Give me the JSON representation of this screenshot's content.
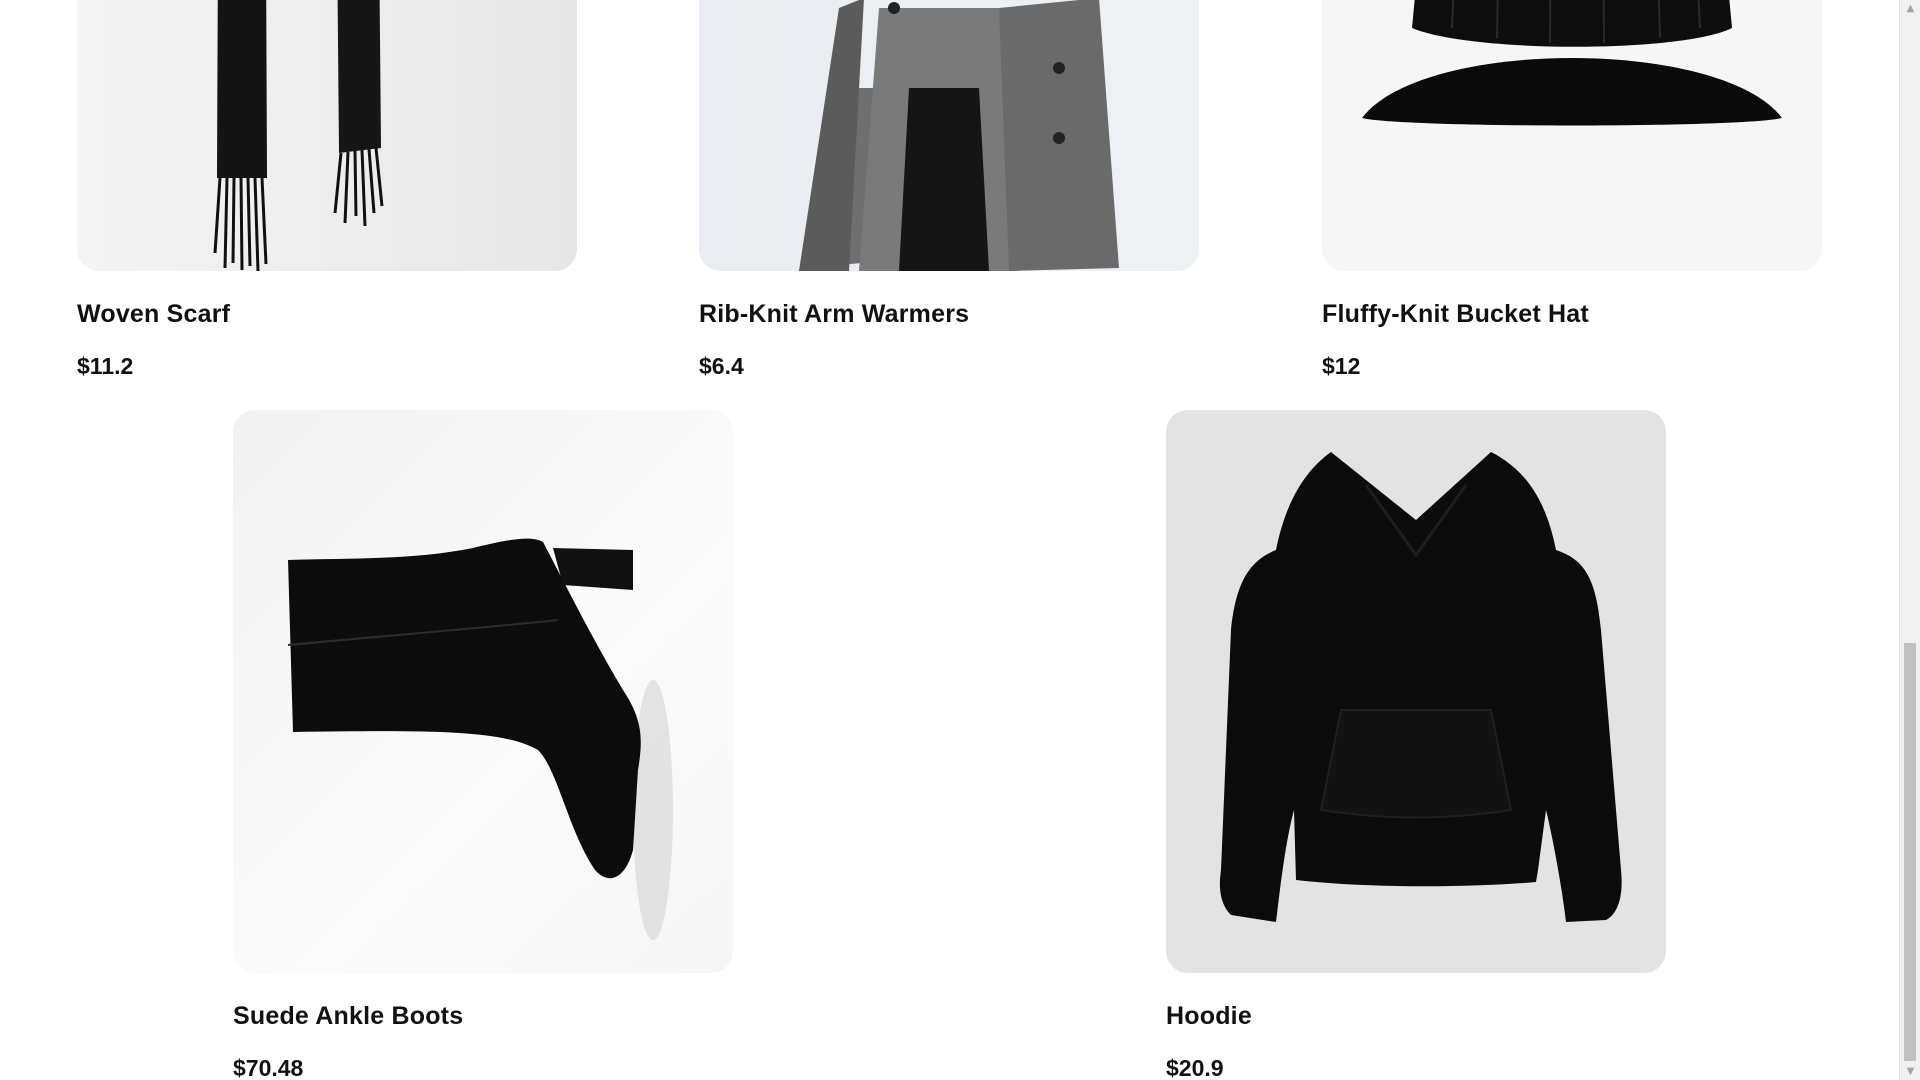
{
  "products": [
    {
      "name": "Woven Scarf",
      "price": "$11.2",
      "image_icon": "scarf-image"
    },
    {
      "name": "Rib-Knit Arm Warmers",
      "price": "$6.4",
      "image_icon": "coat-model-image"
    },
    {
      "name": "Fluffy-Knit Bucket Hat",
      "price": "$12",
      "image_icon": "bucket-hat-image"
    },
    {
      "name": "Suede Ankle Boots",
      "price": "$70.48",
      "image_icon": "ankle-boot-image"
    },
    {
      "name": "Hoodie",
      "price": "$20.9",
      "image_icon": "hoodie-image"
    }
  ],
  "scrollbar": {
    "up_glyph": "▲",
    "down_glyph": "▼",
    "scroll_position": 0.98
  },
  "colors": {
    "text": "#111111",
    "background": "#ffffff",
    "scrollbar_track": "#f1f1f1",
    "scrollbar_thumb": "#c1c1c1"
  }
}
